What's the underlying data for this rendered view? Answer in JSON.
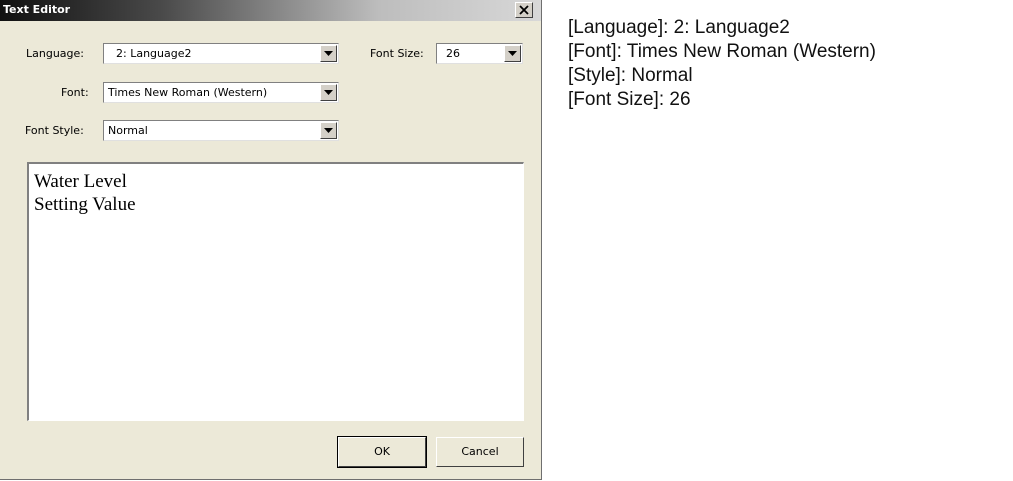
{
  "dialog": {
    "title": "Text Editor",
    "language": {
      "label": "Language:",
      "value": "2: Language2"
    },
    "font_size": {
      "label": "Font Size:",
      "value": "26"
    },
    "font": {
      "label": "Font:",
      "value": "Times New Roman (Western)"
    },
    "font_style": {
      "label": "Font Style:",
      "value": "Normal"
    },
    "text_lines": [
      "Water Level",
      "Setting Value"
    ],
    "ok_label": "OK",
    "cancel_label": "Cancel"
  },
  "notes": [
    "[Language]: 2: Language2",
    "[Font]: Times New Roman (Western)",
    "[Style]: Normal",
    "[Font Size]: 26"
  ]
}
